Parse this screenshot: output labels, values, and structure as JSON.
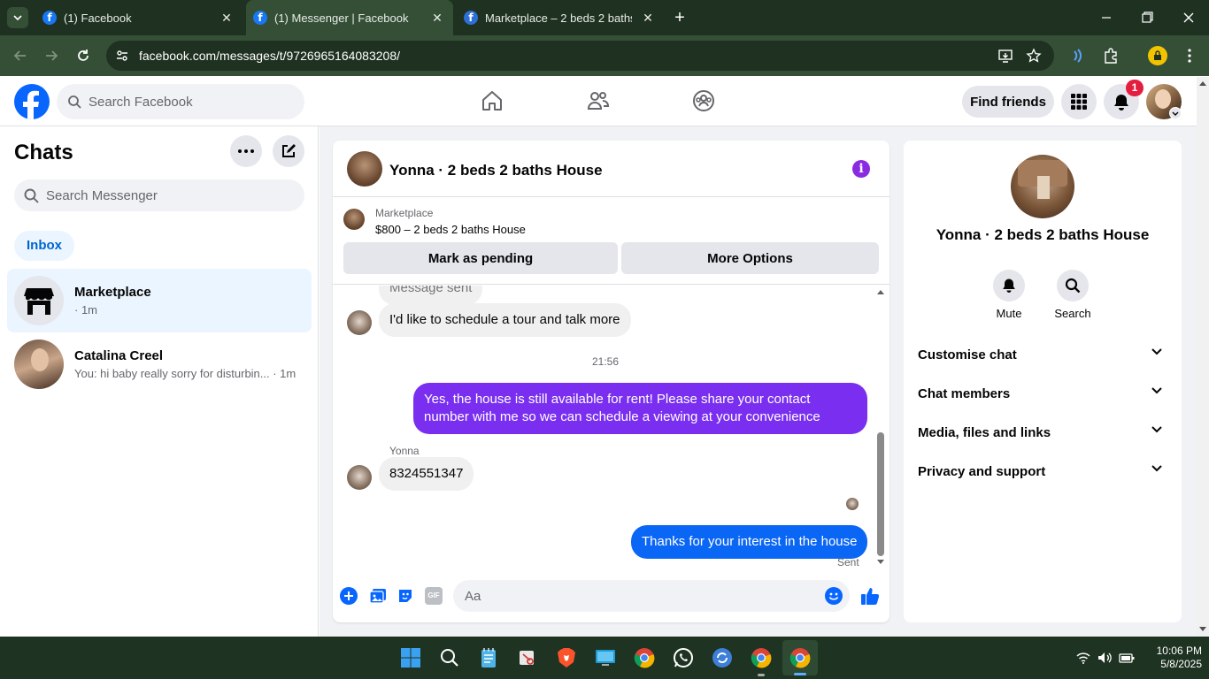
{
  "browser": {
    "tabs": [
      {
        "title": "(1) Facebook",
        "active": false
      },
      {
        "title": "(1) Messenger | Facebook",
        "active": true
      },
      {
        "title": "Marketplace – 2 beds 2 baths H",
        "active": false
      }
    ],
    "url": "facebook.com/messages/t/9726965164083208/"
  },
  "header": {
    "search_placeholder": "Search Facebook",
    "find_friends": "Find friends",
    "notification_count": "1"
  },
  "sidebar": {
    "title": "Chats",
    "search_placeholder": "Search Messenger",
    "filter_inbox": "Inbox",
    "conversations": [
      {
        "name": "Marketplace",
        "preview": "· 1m",
        "selected": true
      },
      {
        "name": "Catalina Creel",
        "preview": "You: hi baby really sorry for disturbin... · 1m",
        "selected": false
      }
    ]
  },
  "chat": {
    "title": "Yonna · 2 beds 2 baths House",
    "marketplace_label": "Marketplace",
    "listing": "$800 – 2 beds 2 baths House",
    "mark_pending": "Mark as pending",
    "more_options": "More Options",
    "partial_text": "Message sent",
    "messages": [
      {
        "text": "I'd like to schedule a tour and talk more"
      },
      {
        "time": "21:56"
      },
      {
        "text": "Yes, the house is still available for rent! Please share your contact number with me so we can schedule a viewing at your convenience"
      },
      {
        "sender": "Yonna",
        "text": "8324551347"
      },
      {
        "text": "Thanks for your interest in the house",
        "status": "Sent"
      }
    ],
    "input_placeholder": "Aa",
    "colors": {
      "outgoing_purple": "#7a2ff0",
      "outgoing_blue": "#0a66f5",
      "accent": "#0866ff"
    }
  },
  "info": {
    "name": "Yonna · 2 beds 2 baths House",
    "actions": [
      {
        "label": "Mute"
      },
      {
        "label": "Search"
      }
    ],
    "sections": [
      "Customise chat",
      "Chat members",
      "Media, files and links",
      "Privacy and support"
    ]
  },
  "taskbar": {
    "time": "10:06 PM",
    "date": "5/8/2025"
  }
}
